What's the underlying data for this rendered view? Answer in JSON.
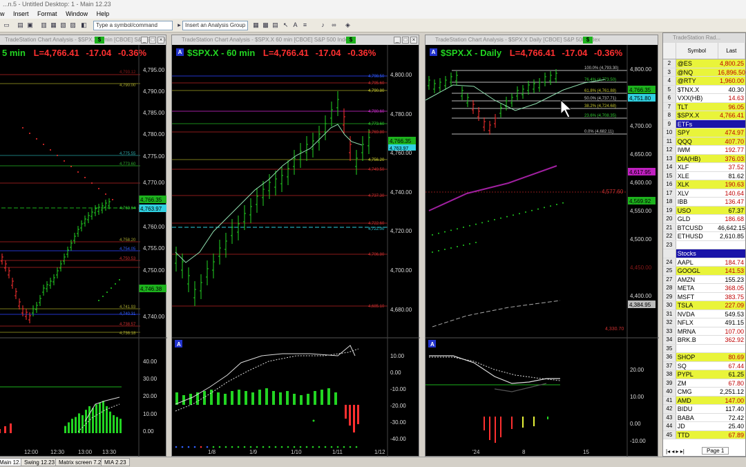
{
  "window": {
    "title": "...n.5 - Untitled Desktop: 1 - Main 12.23"
  },
  "menu": [
    "w",
    "Insert",
    "Format",
    "Window",
    "Help"
  ],
  "toolbar": {
    "symbol_placeholder": "Type a symbol/command",
    "analysis_group": "Insert an Analysis Group"
  },
  "colors": {
    "up": "#22d422",
    "down": "#ff3030",
    "accent": "#1a14a8",
    "highlight": "#e9f43a"
  },
  "charts": [
    {
      "header": "TradeStation Chart Analysis - $SPX.X 5 min [CBOE] S&P 500 Index",
      "symbol_label": "5 min",
      "last": "L=4,766.41",
      "chg": "-17.04",
      "pct": "-0.36%",
      "price_ticks": [
        "4,795.00",
        "4,790.00",
        "4,785.00",
        "4,780.00",
        "4,775.00",
        "4,770.00",
        "4,765.00",
        "4,760.00",
        "4,755.00",
        "4,750.00",
        "4,745.00",
        "4,740.00"
      ],
      "level_labels": [
        "4,793.12",
        "4,790.00",
        "4,775.55",
        "4,773.60",
        "4,766.35",
        "4,763.97",
        "4,763.64",
        "4,758.20",
        "4,754.05",
        "4,750.53",
        "4,746.38",
        "4,741.93",
        "4,740.31",
        "4,738.57",
        "4,736.18"
      ],
      "osc_ticks": [
        "40.00",
        "30.00",
        "20.00",
        "10.00",
        "0.00"
      ],
      "time_ticks": [
        "12:00",
        "12:30",
        "13:00",
        "13:30"
      ]
    },
    {
      "header": "TradeStation Chart Analysis - $SPX.X 60 min [CBOE] S&P 500 Index",
      "symbol_label": "$SPX.X - 60 min",
      "last": "L=4,766.41",
      "chg": "-17.04",
      "pct": "-0.36%",
      "price_ticks": [
        "4,800.00",
        "4,780.00",
        "4,760.00",
        "4,740.00",
        "4,720.00",
        "4,700.00",
        "4,680.00"
      ],
      "level_labels": [
        "4,798.50",
        "4,795.60",
        "4,790.80",
        "4,780.60",
        "4,773.60",
        "4,769.80",
        "4,766.35",
        "4,763.97",
        "4,756.20",
        "4,749.50",
        "4,737.30",
        "4,722.60",
        "4,722.00",
        "4,706.80",
        "4,685.10"
      ],
      "osc_ticks": [
        "10.00",
        "0.00",
        "-10.00",
        "-20.00",
        "-30.00",
        "-40.00"
      ],
      "time_ticks": [
        "1/8",
        "1/9",
        "1/10",
        "1/11",
        "1/12"
      ]
    },
    {
      "header": "TradeStation Chart Analysis - $SPX.X Daily [CBOE] S&P 500 Index",
      "symbol_label": "$SPX.X - Daily",
      "last": "L=4,766.41",
      "chg": "-17.04",
      "pct": "-0.36%",
      "price_ticks": [
        "4,800.00",
        "4,750.00",
        "4,700.00",
        "4,650.00",
        "4,600.00",
        "4,550.00",
        "4,500.00",
        "4,450.00",
        "4,400.00"
      ],
      "fib_labels": [
        "100.0% (4,793.30)",
        "76.4% (4,773.50)",
        "61.8% (4,761.88)",
        "50.0% (4,737.71)",
        "38.2% (4,724.68)",
        "23.6% (4,708.35)",
        "0.0% (4,682.11)"
      ],
      "level_labels": [
        "4,766.35",
        "4,751.80",
        "4,617.95",
        "4,577.60",
        "4,569.92",
        "4,384.95",
        "4,330.70"
      ],
      "osc_ticks": [
        "20.00",
        "10.00",
        "0.00",
        "-10.00"
      ],
      "time_ticks": [
        "'24",
        "8",
        "15"
      ]
    }
  ],
  "radar": {
    "header": "TradeStation Rad...",
    "col_symbol": "Symbol",
    "col_last": "Last",
    "rows": [
      {
        "n": "2",
        "s": "@ES",
        "l": "4,800.25",
        "c": "yellow",
        "red": true
      },
      {
        "n": "3",
        "s": "@NQ",
        "l": "16,896.50",
        "c": "yellow",
        "red": true
      },
      {
        "n": "4",
        "s": "@RTY",
        "l": "1,960.00",
        "c": "yellow",
        "red": true
      },
      {
        "n": "5",
        "s": "$TNX.X",
        "l": "40.30",
        "c": "",
        "red": false
      },
      {
        "n": "6",
        "s": "VXX(HB)",
        "l": "14.63",
        "c": "",
        "red": true
      },
      {
        "n": "7",
        "s": "TLT",
        "l": "96.05",
        "c": "yellow",
        "red": true
      },
      {
        "n": "8",
        "s": "$SPX.X",
        "l": "4,766.41",
        "c": "yellow",
        "red": true
      },
      {
        "n": "9",
        "s": "ETFs",
        "l": "",
        "c": "hdr",
        "red": false
      },
      {
        "n": "10",
        "s": "SPY",
        "l": "474.97",
        "c": "yellow",
        "red": true
      },
      {
        "n": "11",
        "s": "QQQ",
        "l": "407.70",
        "c": "yellow",
        "red": true
      },
      {
        "n": "12",
        "s": "IWM",
        "l": "192.77",
        "c": "",
        "red": true
      },
      {
        "n": "13",
        "s": "DIA(HB)",
        "l": "376.03",
        "c": "yellow",
        "red": true
      },
      {
        "n": "14",
        "s": "XLF",
        "l": "37.52",
        "c": "",
        "red": true
      },
      {
        "n": "15",
        "s": "XLE",
        "l": "81.62",
        "c": "",
        "red": false
      },
      {
        "n": "16",
        "s": "XLK",
        "l": "190.63",
        "c": "yellow",
        "red": true
      },
      {
        "n": "17",
        "s": "XLV",
        "l": "140.64",
        "c": "",
        "red": true
      },
      {
        "n": "18",
        "s": "IBB",
        "l": "136.47",
        "c": "",
        "red": true
      },
      {
        "n": "19",
        "s": "USO",
        "l": "67.37",
        "c": "yellow",
        "red": false
      },
      {
        "n": "20",
        "s": "GLD",
        "l": "186.68",
        "c": "",
        "red": true
      },
      {
        "n": "21",
        "s": "BTCUSD",
        "l": "46,642.15",
        "c": "",
        "red": false
      },
      {
        "n": "22",
        "s": "ETHUSD",
        "l": "2,610.85",
        "c": "",
        "red": false
      },
      {
        "n": "23",
        "s": "",
        "l": "",
        "c": "",
        "red": false
      },
      {
        "n": "",
        "s": "Stocks",
        "l": "",
        "c": "hdr",
        "red": false
      },
      {
        "n": "24",
        "s": "AAPL",
        "l": "184.74",
        "c": "",
        "red": true
      },
      {
        "n": "25",
        "s": "GOOGL",
        "l": "141.53",
        "c": "yellow",
        "red": true
      },
      {
        "n": "27",
        "s": "AMZN",
        "l": "155.23",
        "c": "",
        "red": false
      },
      {
        "n": "28",
        "s": "META",
        "l": "368.05",
        "c": "",
        "red": true
      },
      {
        "n": "29",
        "s": "MSFT",
        "l": "383.75",
        "c": "",
        "red": true
      },
      {
        "n": "30",
        "s": "TSLA",
        "l": "227.09",
        "c": "yellow",
        "red": true
      },
      {
        "n": "31",
        "s": "NVDA",
        "l": "549.53",
        "c": "",
        "red": false
      },
      {
        "n": "32",
        "s": "NFLX",
        "l": "491.15",
        "c": "",
        "red": false
      },
      {
        "n": "33",
        "s": "MRNA",
        "l": "107.00",
        "c": "",
        "red": true
      },
      {
        "n": "34",
        "s": "BRK.B",
        "l": "362.92",
        "c": "",
        "red": true
      },
      {
        "n": "35",
        "s": "",
        "l": "",
        "c": "",
        "red": false
      },
      {
        "n": "36",
        "s": "SHOP",
        "l": "80.69",
        "c": "yellow",
        "red": true
      },
      {
        "n": "37",
        "s": "SQ",
        "l": "67.44",
        "c": "",
        "red": true
      },
      {
        "n": "38",
        "s": "PYPL",
        "l": "61.25",
        "c": "yellow",
        "red": false
      },
      {
        "n": "39",
        "s": "ZM",
        "l": "67.80",
        "c": "",
        "red": true
      },
      {
        "n": "40",
        "s": "CMG",
        "l": "2,251.12",
        "c": "",
        "red": false
      },
      {
        "n": "41",
        "s": "AMD",
        "l": "147.00",
        "c": "yellow",
        "red": true
      },
      {
        "n": "42",
        "s": "BIDU",
        "l": "117.40",
        "c": "",
        "red": false
      },
      {
        "n": "43",
        "s": "BABA",
        "l": "72.42",
        "c": "",
        "red": false
      },
      {
        "n": "44",
        "s": "JD",
        "l": "25.40",
        "c": "",
        "red": false
      },
      {
        "n": "45",
        "s": "TTD",
        "l": "67.89",
        "c": "yellow",
        "red": true
      }
    ],
    "page_tab": "Page 1"
  },
  "tabs": [
    "Main 12.23",
    "Swing 12.23",
    "Matrix screen 7.23",
    "MIA 2.23"
  ]
}
